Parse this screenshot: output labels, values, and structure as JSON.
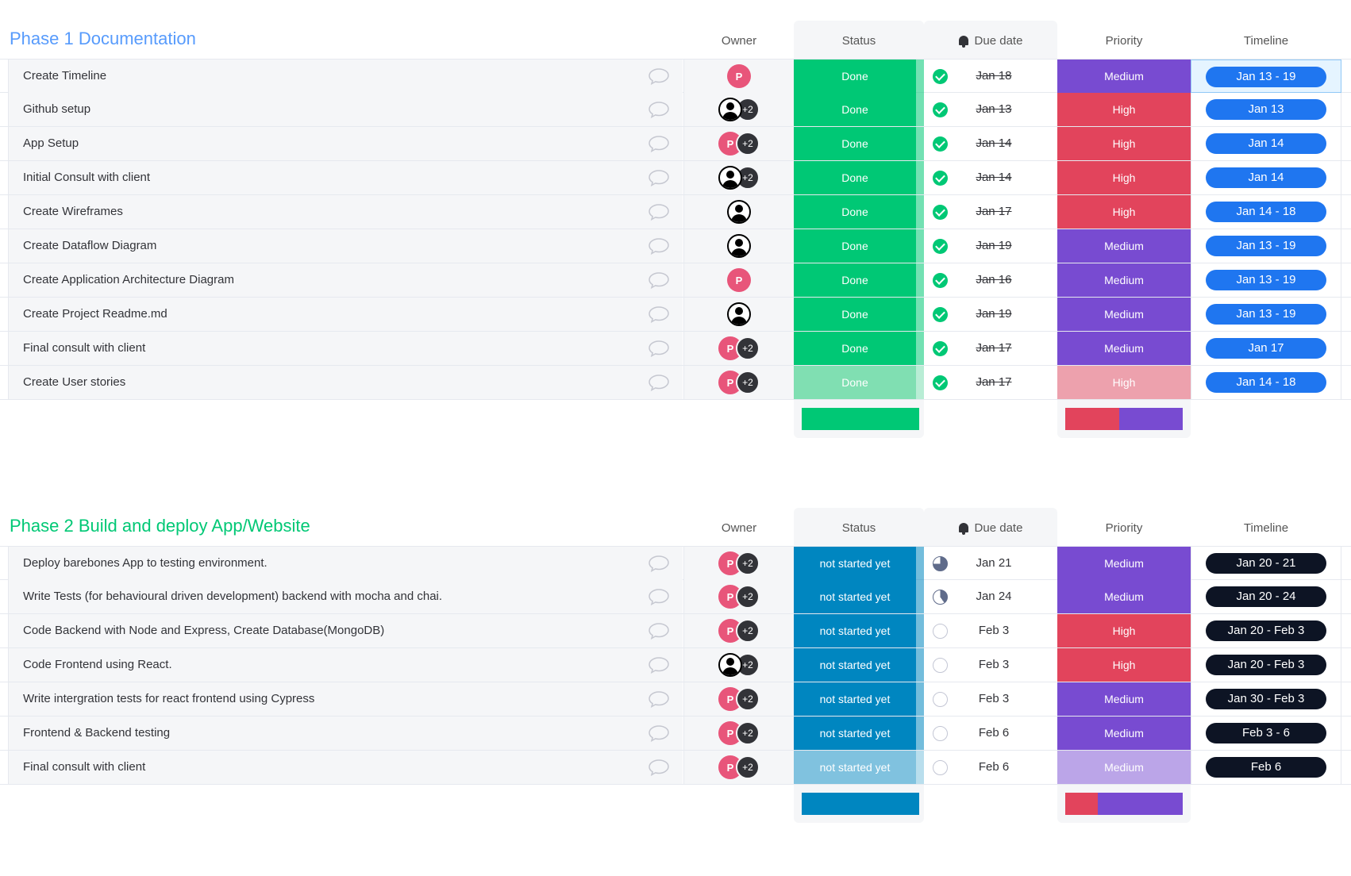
{
  "columns": {
    "owner": "Owner",
    "status": "Status",
    "due": "Due date",
    "priority": "Priority",
    "timeline": "Timeline"
  },
  "colors": {
    "done": "#00c875",
    "not_started": "#0086c0",
    "medium": "#784bd1",
    "high": "#e2445c",
    "pill_blue": "#1f76f0",
    "pill_dark": "#0d1424"
  },
  "groups": [
    {
      "title": "Phase 1 Documentation",
      "title_color": "#579bfc",
      "pill_color": "#1f76f0",
      "summary": {
        "status_color": "#00c875",
        "priority_split": [
          {
            "color": "#e2445c",
            "share": 0.46
          },
          {
            "color": "#784bd1",
            "share": 0.54
          }
        ]
      },
      "rows": [
        {
          "name": "Create Timeline",
          "owner": [
            "p"
          ],
          "status": "Done",
          "status_color": "#00c875",
          "due_icon": "done",
          "due": "Jan 18",
          "priority": "Medium",
          "priority_color": "#784bd1",
          "timeline": "Jan 13 - 19",
          "selected": true
        },
        {
          "name": "Github setup",
          "owner": [
            "person",
            "+2"
          ],
          "status": "Done",
          "status_color": "#00c875",
          "due_icon": "done",
          "due": "Jan 13",
          "priority": "High",
          "priority_color": "#e2445c",
          "timeline": "Jan 13"
        },
        {
          "name": "App Setup",
          "owner": [
            "p",
            "+2"
          ],
          "status": "Done",
          "status_color": "#00c875",
          "due_icon": "done",
          "due": "Jan 14",
          "priority": "High",
          "priority_color": "#e2445c",
          "timeline": "Jan 14"
        },
        {
          "name": "Initial Consult with client",
          "owner": [
            "person",
            "+2"
          ],
          "status": "Done",
          "status_color": "#00c875",
          "due_icon": "done",
          "due": "Jan 14",
          "priority": "High",
          "priority_color": "#e2445c",
          "timeline": "Jan 14"
        },
        {
          "name": "Create Wireframes",
          "owner": [
            "person"
          ],
          "status": "Done",
          "status_color": "#00c875",
          "due_icon": "done",
          "due": "Jan 17",
          "priority": "High",
          "priority_color": "#e2445c",
          "timeline": "Jan 14 - 18"
        },
        {
          "name": "Create Dataflow Diagram",
          "owner": [
            "person"
          ],
          "status": "Done",
          "status_color": "#00c875",
          "due_icon": "done",
          "due": "Jan 19",
          "priority": "Medium",
          "priority_color": "#784bd1",
          "timeline": "Jan 13 - 19"
        },
        {
          "name": "Create Application Architecture Diagram",
          "owner": [
            "p"
          ],
          "status": "Done",
          "status_color": "#00c875",
          "due_icon": "done",
          "due": "Jan 16",
          "priority": "Medium",
          "priority_color": "#784bd1",
          "timeline": "Jan 13 - 19"
        },
        {
          "name": "Create Project Readme.md",
          "owner": [
            "person"
          ],
          "status": "Done",
          "status_color": "#00c875",
          "due_icon": "done",
          "due": "Jan 19",
          "priority": "Medium",
          "priority_color": "#784bd1",
          "timeline": "Jan 13 - 19"
        },
        {
          "name": "Final consult with client",
          "owner": [
            "p",
            "+2"
          ],
          "status": "Done",
          "status_color": "#00c875",
          "due_icon": "done",
          "due": "Jan 17",
          "priority": "Medium",
          "priority_color": "#784bd1",
          "timeline": "Jan 17"
        },
        {
          "name": "Create User stories",
          "owner": [
            "p",
            "+2"
          ],
          "status": "Done",
          "status_color": "#80dfb2",
          "due_icon": "done",
          "due": "Jan 17",
          "priority": "High",
          "priority_color": "#eda1ad",
          "timeline": "Jan 14 - 18"
        }
      ]
    },
    {
      "title": "Phase 2 Build and deploy App/Website",
      "title_color": "#00c875",
      "pill_color": "#0d1424",
      "summary": {
        "status_color": "#0086c0",
        "priority_split": [
          {
            "color": "#e2445c",
            "share": 0.28
          },
          {
            "color": "#784bd1",
            "share": 0.72
          }
        ]
      },
      "rows": [
        {
          "name": "Deploy barebones App to testing environment.",
          "owner": [
            "p",
            "+2"
          ],
          "status": "not started yet",
          "status_color": "#0086c0",
          "due_icon": "pie",
          "due": "Jan 21",
          "priority": "Medium",
          "priority_color": "#784bd1",
          "timeline": "Jan 20 - 21"
        },
        {
          "name": "Write Tests (for behavioural driven development) backend with mocha and chai.",
          "owner": [
            "p",
            "+2"
          ],
          "status": "not started yet",
          "status_color": "#0086c0",
          "due_icon": "pie-half",
          "due": "Jan 24",
          "priority": "Medium",
          "priority_color": "#784bd1",
          "timeline": "Jan 20 - 24"
        },
        {
          "name": "Code Backend with Node and Express, Create Database(MongoDB)",
          "owner": [
            "p",
            "+2"
          ],
          "status": "not started yet",
          "status_color": "#0086c0",
          "due_icon": "empty",
          "due": "Feb 3",
          "priority": "High",
          "priority_color": "#e2445c",
          "timeline": "Jan 20 - Feb 3"
        },
        {
          "name": "Code Frontend using React.",
          "owner": [
            "person",
            "+2"
          ],
          "status": "not started yet",
          "status_color": "#0086c0",
          "due_icon": "empty",
          "due": "Feb 3",
          "priority": "High",
          "priority_color": "#e2445c",
          "timeline": "Jan 20 - Feb 3"
        },
        {
          "name": "Write intergration tests for react frontend using Cypress",
          "owner": [
            "p",
            "+2"
          ],
          "status": "not started yet",
          "status_color": "#0086c0",
          "due_icon": "empty",
          "due": "Feb 3",
          "priority": "Medium",
          "priority_color": "#784bd1",
          "timeline": "Jan 30 - Feb 3"
        },
        {
          "name": "Frontend & Backend testing",
          "owner": [
            "p",
            "+2"
          ],
          "status": "not started yet",
          "status_color": "#0086c0",
          "due_icon": "empty",
          "due": "Feb 6",
          "priority": "Medium",
          "priority_color": "#784bd1",
          "timeline": "Feb 3 - 6"
        },
        {
          "name": "Final consult with client",
          "owner": [
            "p",
            "+2"
          ],
          "status": "not started yet",
          "status_color": "#80c2df",
          "due_icon": "empty",
          "due": "Feb 6",
          "priority": "Medium",
          "priority_color": "#bba5e8",
          "timeline": "Feb 6"
        }
      ]
    }
  ]
}
